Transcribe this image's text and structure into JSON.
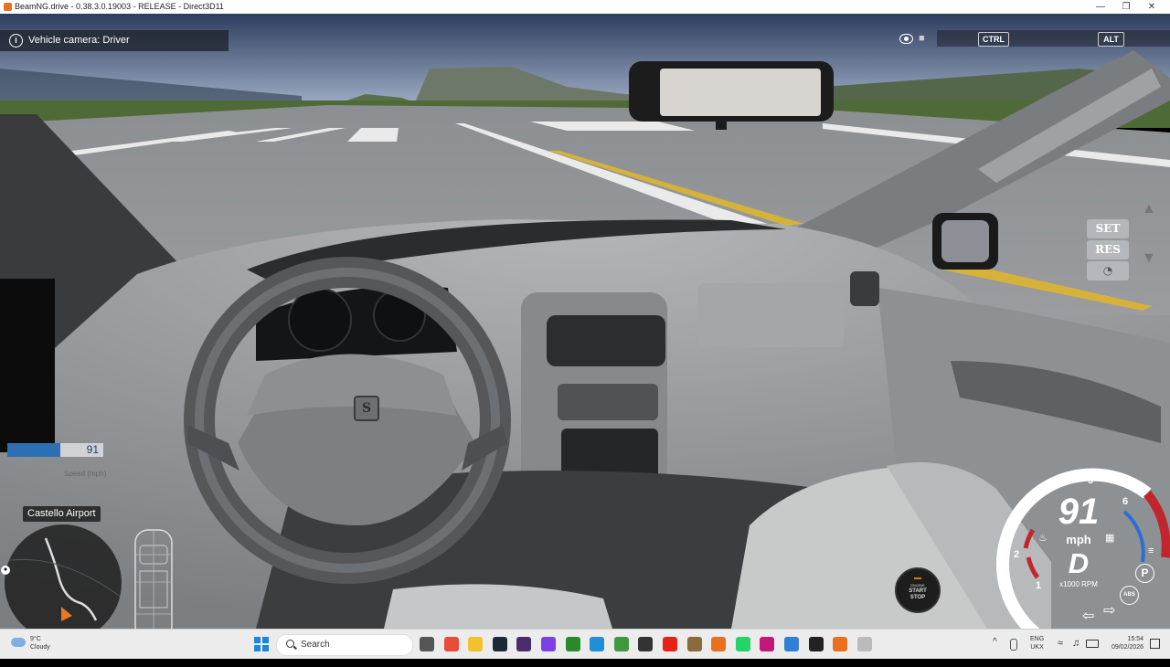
{
  "window": {
    "title": "BeamNG.drive - 0.38.3.0.19003 - RELEASE - Direct3D11",
    "min_glyph": "—",
    "max_glyph": "❐",
    "close_glyph": "✕"
  },
  "hud": {
    "camera_notice": "Vehicle camera: Driver",
    "info_glyph": "i",
    "key_ctrl": "CTRL",
    "key_alt": "ALT",
    "cruise": {
      "set": "SET",
      "res": "RES",
      "gauge_glyph": "◔",
      "up_glyph": "▲",
      "down_glyph": "▼"
    },
    "speed_bar": {
      "value": "91",
      "label": "Speed (mph)",
      "fill_fraction": 0.55
    },
    "location": "Castello Airport",
    "engine_button": {
      "line1": "ENGINE",
      "line2": "START",
      "line3": "STOP"
    },
    "gauge": {
      "speed": "91",
      "unit": "mph",
      "gear": "D",
      "rpm_label": "x1000 RPM",
      "ticks": [
        "1",
        "2",
        "3",
        "4",
        "5",
        "6"
      ],
      "park_glyph": "P",
      "abs_label": "ABS",
      "left_signal": "⇦",
      "right_signal": "⇨"
    }
  },
  "steering_logo": "S",
  "taskbar": {
    "weather": {
      "temp": "9°C",
      "condition": "Cloudy"
    },
    "search_placeholder": "Search",
    "apps": [
      "task-view",
      "chrome",
      "file-explorer",
      "steam",
      "obs",
      "app-purple",
      "xbox",
      "edge",
      "minecraft",
      "app-dark",
      "youtube",
      "game",
      "app-orange",
      "whatsapp",
      "app-magenta",
      "app-blue",
      "terminal",
      "beamng",
      "app-white"
    ],
    "tray": {
      "chevron": "^",
      "lang_top": "ENG",
      "lang_bottom": "UKX",
      "time": "15:54",
      "date": "09/02/2026"
    }
  },
  "colors": {
    "sky": "#3a4a66",
    "speed_fill": "#2c6fb3",
    "gauge_red": "#c0262c",
    "gauge_blue": "#2f6ed1",
    "windows_blue": "#1a86e2"
  }
}
